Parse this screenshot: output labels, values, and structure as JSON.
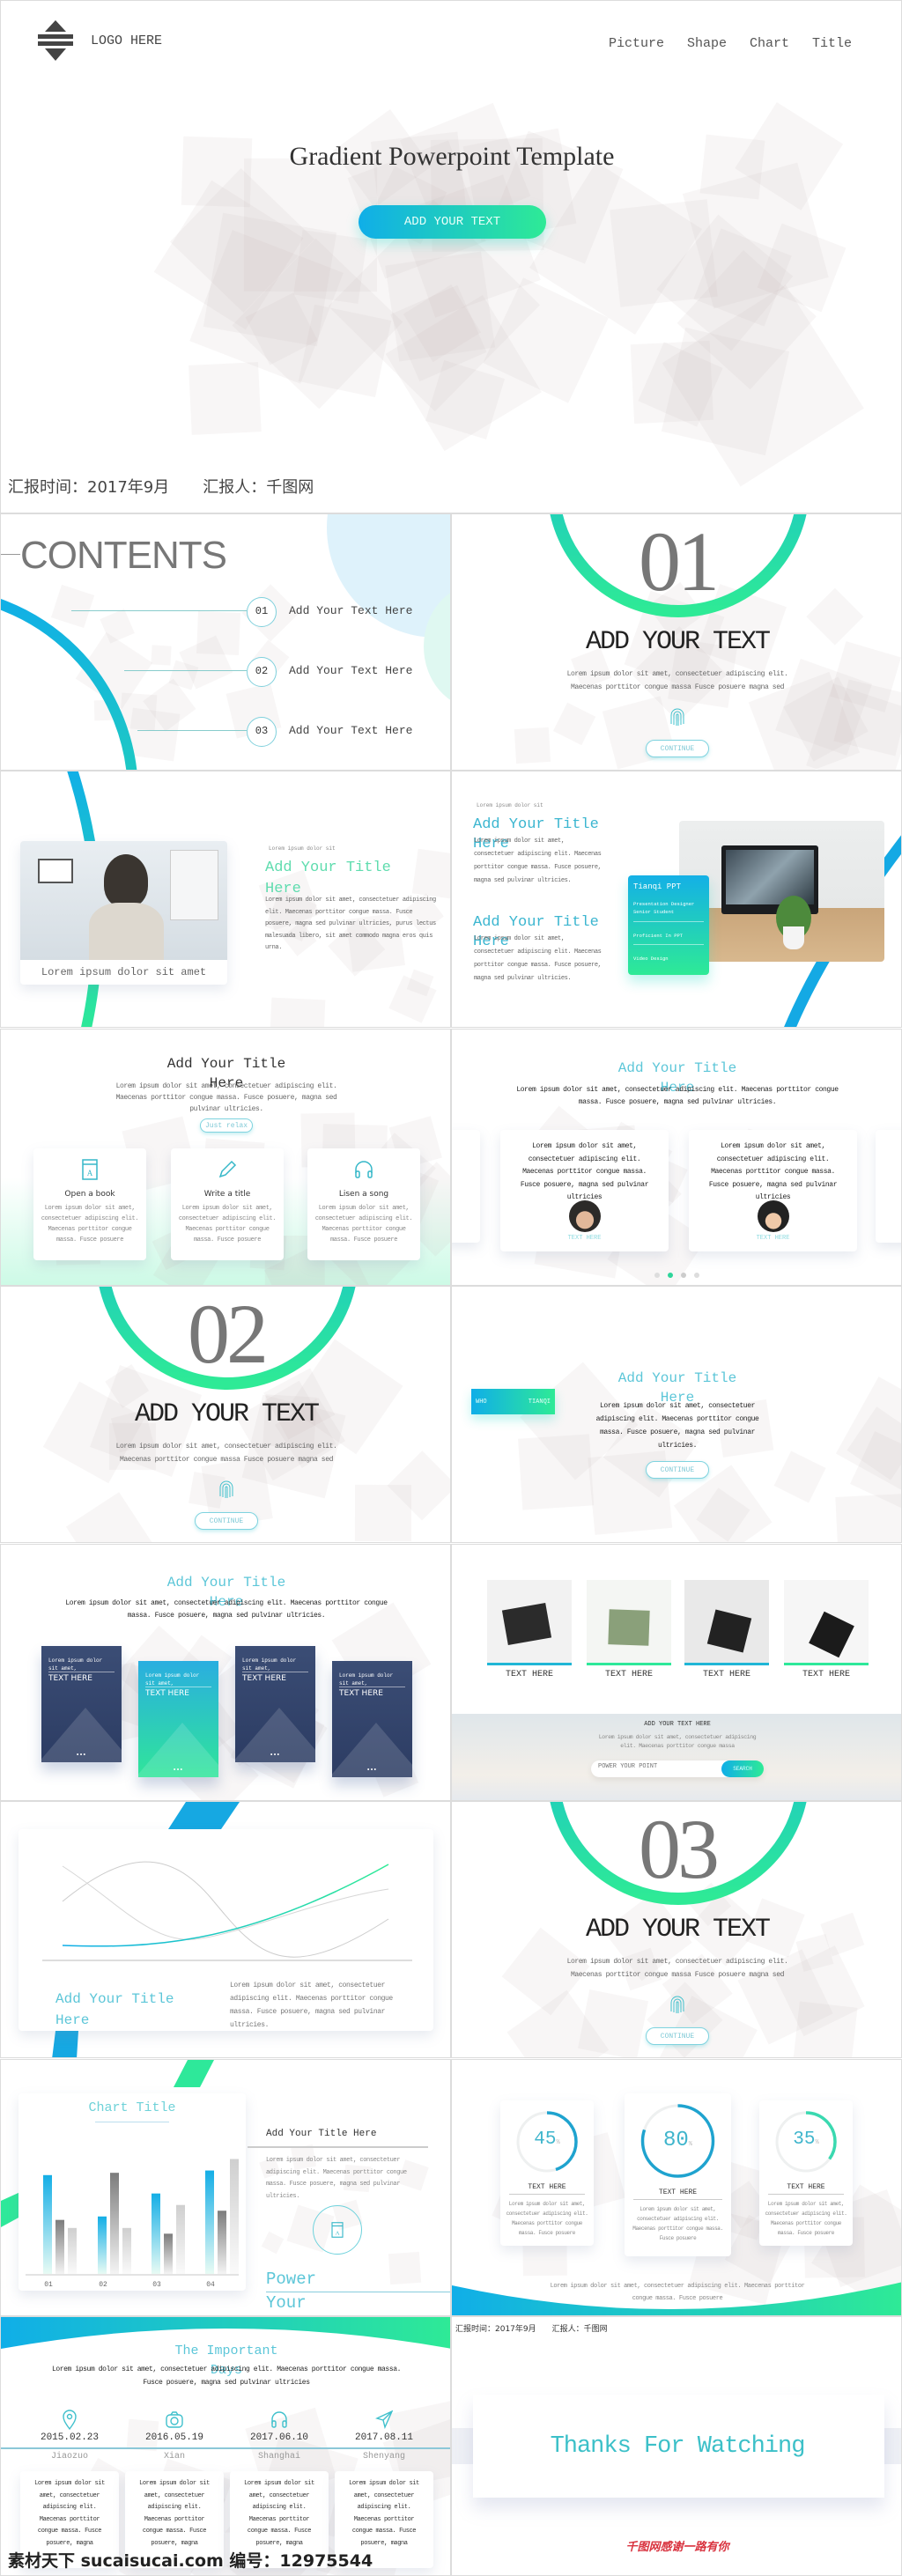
{
  "colors": {
    "blue": "#12aee6",
    "green": "#2ee89a",
    "teal": "#3bb6cf",
    "card_dark": "#34466b",
    "red": "#d9333f"
  },
  "cover": {
    "logo_text": "LOGO HERE",
    "nav": [
      "Picture",
      "Shape",
      "Chart",
      "Title"
    ],
    "title": "Gradient Powerpoint Template",
    "button": "ADD YOUR TEXT",
    "footer_time": "汇报时间：2017年9月",
    "footer_reporter": "汇报人：千图网"
  },
  "contents": {
    "title": "CONTENTS",
    "items": [
      {
        "num": "01",
        "label": "Add Your Text Here"
      },
      {
        "num": "02",
        "label": "Add Your Text Here"
      },
      {
        "num": "03",
        "label": "Add Your Text Here"
      }
    ]
  },
  "sections": [
    {
      "num": "01",
      "title": "ADD YOUR TEXT",
      "text1": "Lorem ipsum dolor sit amet, consectetuer adipiscing elit.",
      "text2": "Maecenas porttitor congue massa Fusce posuere  magna sed",
      "button": "CONTINUE"
    },
    {
      "num": "02",
      "title": "ADD YOUR TEXT",
      "text1": "Lorem ipsum dolor sit amet, consectetuer adipiscing elit.",
      "text2": "Maecenas porttitor congue massa Fusce posuere  magna sed",
      "button": "CONTINUE"
    },
    {
      "num": "03",
      "title": "ADD YOUR TEXT",
      "text1": "Lorem ipsum dolor sit amet, consectetuer adipiscing elit.",
      "text2": "Maecenas porttitor congue massa Fusce posuere  magna sed",
      "button": "CONTINUE"
    }
  ],
  "photo_slide": {
    "caption": "Lorem ipsum dolor sit amet",
    "label": "Lorem ipsum dolor sit",
    "title": "Add Your Title Here",
    "body": "Lorem ipsum dolor sit amet, consectetuer adipiscing elit. Maecenas porttitor congue massa. Fusce posuere, magna sed pulvinar ultricies, purus lectus malesuada libero, sit amet commodo magna eros quis urna."
  },
  "profile_slide": {
    "label": "Lorem ipsum dolor sit",
    "blocks": [
      {
        "title": "Add Your Title Here",
        "body": "Lorem ipsum dolor sit amet, consectetuer adipiscing elit. Maecenas porttitor congue massa. Fusce posuere, magna sed pulvinar ultricies."
      },
      {
        "title": "Add Your Title Here",
        "body": "Lorem ipsum dolor sit amet, consectetuer adipiscing elit. Maecenas porttitor congue massa. Fusce posuere, magna sed pulvinar ultricies."
      }
    ],
    "card": {
      "name": "Tianqi PPT",
      "items": [
        "Presentation Designer Senior Student",
        "Proficient In PPT",
        "Video Design"
      ]
    }
  },
  "features_slide": {
    "title": "Add Your Title Here",
    "text": "Lorem ipsum dolor sit amet, consectetuer adipiscing elit. Maecenas porttitor congue massa. Fusce posuere, magna sed pulvinar ultricies.",
    "button": "Just relax",
    "cards": [
      {
        "icon": "book-icon",
        "title": "Open a book",
        "text": "Lorem ipsum dolor sit amet, consectetuer adipiscing elit. Maecenas porttitor congue massa. Fusce posuere"
      },
      {
        "icon": "pencil-icon",
        "title": "Write a title",
        "text": "Lorem ipsum dolor sit amet, consectetuer adipiscing elit. Maecenas porttitor congue massa. Fusce posuere"
      },
      {
        "icon": "headphones-icon",
        "title": "Lisen a song",
        "text": "Lorem ipsum dolor sit amet, consectetuer adipiscing elit. Maecenas porttitor congue massa. Fusce posuere"
      }
    ]
  },
  "testimonials_slide": {
    "title": "Add Your Title Here",
    "text": "Lorem ipsum dolor sit amet, consectetuer adipiscing elit. Maecenas porttitor congue massa. Fusce posuere, magna sed pulvinar ultricies.",
    "cards": [
      {
        "text": "Lorem ipsum dolor sit amet, consectetuer adipiscing elit. Maecenas porttitor congue massa. Fusce posuere, magna sed pulvinar ultricies",
        "name": "TEXT HERE"
      },
      {
        "text": "Lorem ipsum dolor sit amet, consectetuer adipiscing elit. Maecenas porttitor congue massa. Fusce posuere, magna sed pulvinar ultricies",
        "name": "TEXT HERE"
      }
    ],
    "dot_count": 4,
    "active_dot": 2
  },
  "who_slide": {
    "tab_left": "WHO",
    "tab_right": "TIANQI",
    "title": "Add Your Title Here",
    "text": "Lorem ipsum dolor sit amet, consectetuer adipiscing elit. Maecenas porttitor congue massa. Fusce posuere, magna sed pulvinar ultricies.",
    "button": "CONTINUE"
  },
  "cards_slide": {
    "title": "Add Your Title Here",
    "text": "Lorem ipsum dolor sit amet, consectetuer adipiscing elit. Maecenas porttitor congue massa. Fusce posuere, magna sed pulvinar ultricies.",
    "cards": [
      {
        "text": "Lorem ipsum dolor sit amet, consectetuer",
        "label": "TEXT HERE"
      },
      {
        "text": "Lorem ipsum dolor sit amet, consectetuer",
        "label": "TEXT HERE"
      },
      {
        "text": "Lorem ipsum dolor sit amet, consectetuer",
        "label": "TEXT HERE"
      },
      {
        "text": "Lorem ipsum dolor sit amet, consectetuer",
        "label": "TEXT HERE"
      }
    ]
  },
  "gallery_slide": {
    "items": [
      "TEXT HERE",
      "TEXT HERE",
      "TEXT HERE",
      "TEXT HERE"
    ],
    "heading": "ADD YOUR TEXT HERE",
    "text": "Lorem ipsum dolor sit amet, consectetuer adipiscing elit. Maecenas porttitor congue massa",
    "search_placeholder": "POWER YOUR POINT",
    "search_button": "SEARCH"
  },
  "wave_slide": {
    "title": "Add Your Title Here",
    "text": "Lorem ipsum dolor sit amet, consectetuer adipiscing elit. Maecenas porttitor congue massa. Fusce posuere, magna sed pulvinar ultricies."
  },
  "chart_slide": {
    "title": "Add Your Title Here",
    "text": "Lorem ipsum dolor sit amet, consectetuer adipiscing elit. Maecenas porttitor congue massa. Fusce posuere, magna sed pulvinar ultricies.",
    "tagline": "Power Your Point"
  },
  "chart_data": {
    "type": "bar",
    "title": "Chart Title",
    "categories": [
      "01",
      "02",
      "03",
      "04"
    ],
    "series": [
      {
        "values": [
          86,
          50,
          70,
          90
        ]
      },
      {
        "values": [
          47,
          88,
          35,
          55
        ]
      },
      {
        "values": [
          40,
          40,
          60,
          100
        ]
      }
    ],
    "series_colors": [
      "#14aee6",
      "#8a8a8a",
      "#d4d4d4"
    ],
    "ylim": [
      0,
      105
    ],
    "grid": false
  },
  "progress_slide": {
    "cards": [
      {
        "value": 45,
        "unit": "%",
        "label": "TEXT HERE",
        "text": "Lorem ipsum dolor sit amet, consectetuer adipiscing elit. Maecenas porttitor congue massa. Fusce posuere"
      },
      {
        "value": 80,
        "unit": "%",
        "label": "TEXT HERE",
        "text": "Lorem ipsum dolor sit amet, consectetuer adipiscing elit. Maecenas porttitor congue massa. Fusce posuere"
      },
      {
        "value": 35,
        "unit": "%",
        "label": "TEXT HERE",
        "text": "Lorem ipsum dolor sit amet, consectetuer adipiscing elit. Maecenas porttitor congue massa. Fusce posuere"
      }
    ],
    "footer": "Lorem ipsum dolor sit amet, consectetuer adipiscing elit. Maecenas porttitor congue massa. Fusce posuere"
  },
  "timeline_slide": {
    "title": "The Important Days",
    "text": "Lorem ipsum dolor sit amet, consectetuer adipiscing elit. Maecenas porttitor congue massa. Fusce posuere, magna sed pulvinar ultricies",
    "events": [
      {
        "icon": "location-pin-icon",
        "date": "2015.02.23",
        "city": "Jiaozuo",
        "text": "Lorem ipsum dolor sit amet, consectetuer adipiscing elit. Maecenas porttitor congue massa. Fusce posuere, magna"
      },
      {
        "icon": "camera-icon",
        "date": "2016.05.19",
        "city": "Xian",
        "text": "Lorem ipsum dolor sit amet, consectetuer adipiscing elit. Maecenas porttitor congue massa. Fusce posuere, magna"
      },
      {
        "icon": "headphones-icon",
        "date": "2017.06.10",
        "city": "Shanghai",
        "text": "Lorem ipsum dolor sit amet, consectetuer adipiscing elit. Maecenas porttitor congue massa. Fusce posuere, magna"
      },
      {
        "icon": "paper-plane-icon",
        "date": "2017.08.11",
        "city": "Shenyang",
        "text": "Lorem ipsum dolor sit amet, consectetuer adipiscing elit. Maecenas porttitor congue massa. Fusce posuere, magna"
      }
    ]
  },
  "thanks_slide": {
    "header_time": "汇报时间：2017年9月",
    "header_reporter": "汇报人：千图网",
    "title": "Thanks For Watching",
    "slogan": "千图网感谢一路有你"
  },
  "watermark": "素材天下 sucaisucai.com  编号：12975544"
}
